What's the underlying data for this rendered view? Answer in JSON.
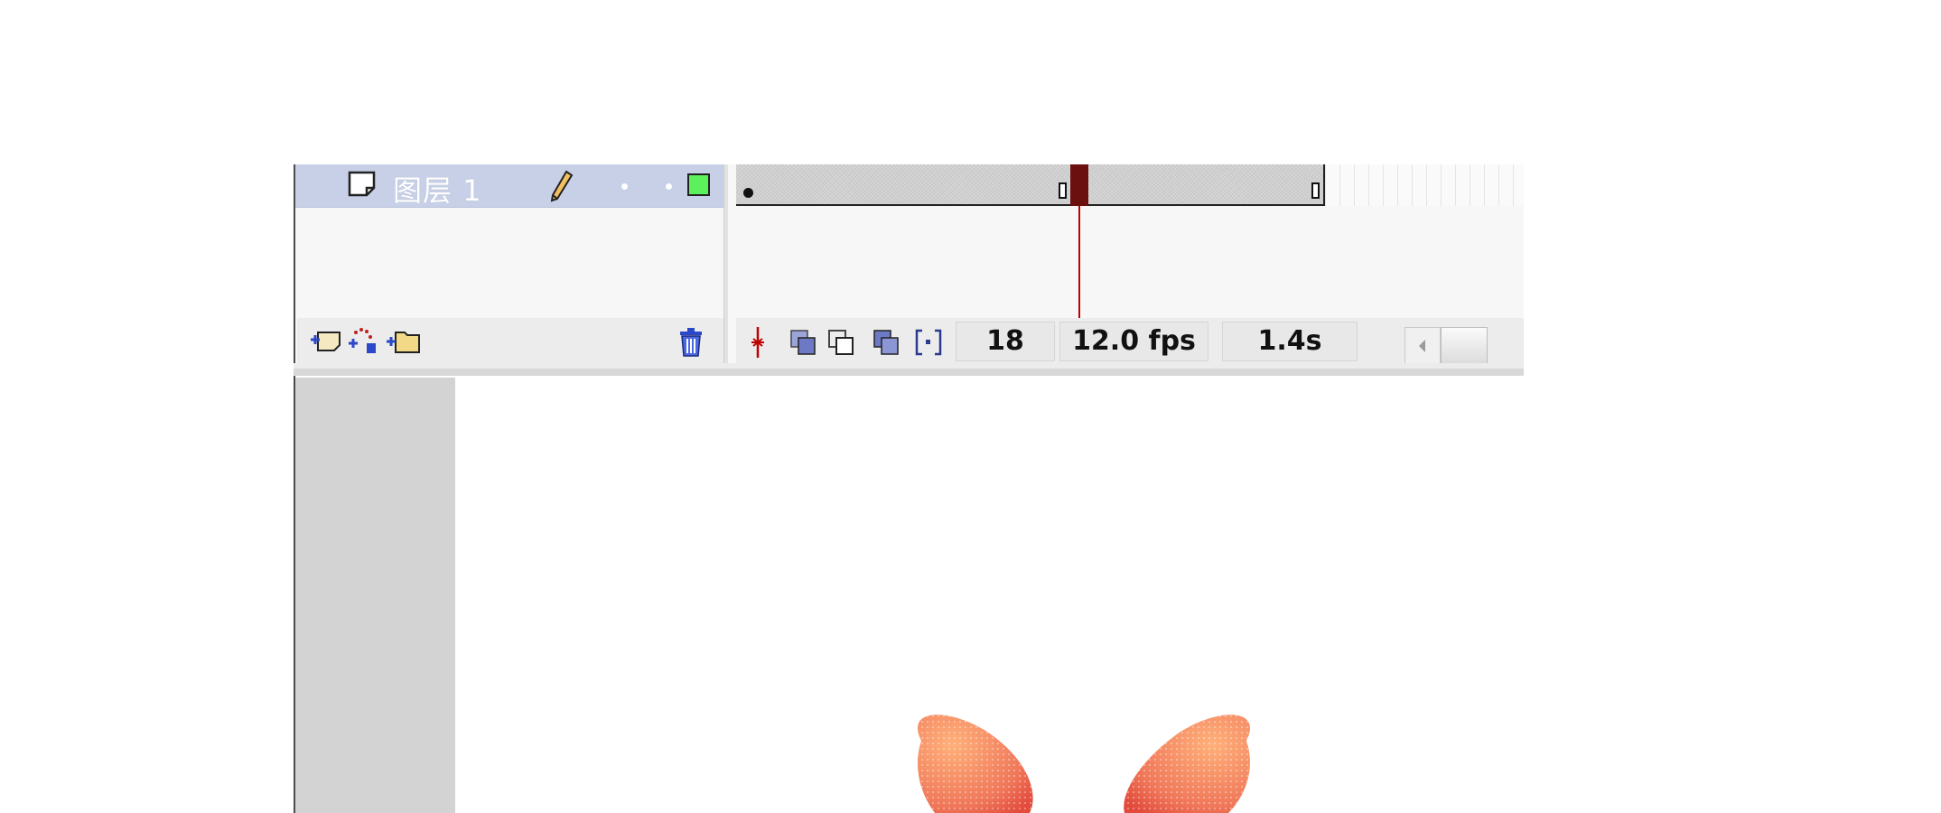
{
  "timeline": {
    "layer": {
      "name": "图层 1",
      "icon": "layer-page-icon",
      "edit_icon": "pencil-icon",
      "outline_color": "#5cf05c"
    },
    "layer_toolbar": {
      "icons": [
        "add-layer-icon",
        "add-motion-guide-icon",
        "add-folder-icon",
        "delete-layer-icon"
      ]
    },
    "frame_toolbar": {
      "icons": [
        "center-frame-icon",
        "onion-skin-icon",
        "onion-skin-outlines-icon",
        "edit-multiple-frames-icon",
        "modify-onion-markers-icon"
      ],
      "current_frame": "18",
      "frame_rate": "12.0 fps",
      "elapsed_time": "1.4s"
    },
    "colors": {
      "layer_selected_bg": "#c7d0e6",
      "playhead": "#c00000"
    }
  },
  "stage": {
    "background": "#ffffff",
    "gutter": "#d3d3d3",
    "artwork": "flower-petals",
    "petal_color": "#f0785a"
  }
}
